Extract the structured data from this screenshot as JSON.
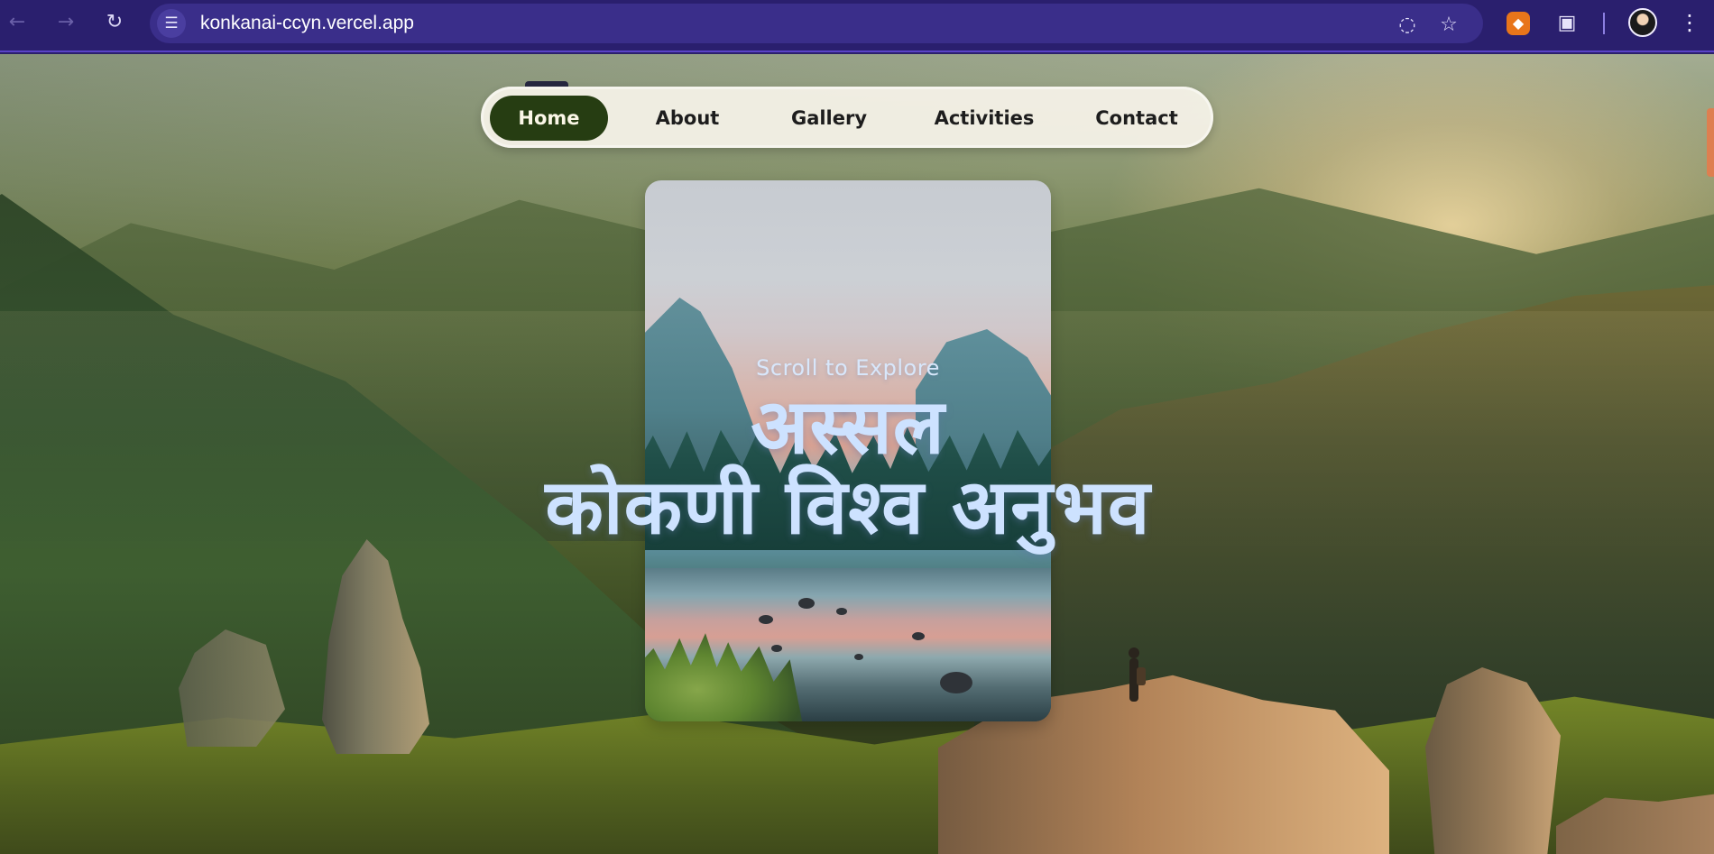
{
  "browser": {
    "url": "konkanai-ccyn.vercel.app",
    "icons": {
      "back": "arrow-left-icon",
      "forward": "arrow-right-icon",
      "reload": "reload-icon",
      "site_info": "site-info-icon",
      "hide": "eye-off-icon",
      "bookmark": "star-icon",
      "extension_metamask": "fox-icon",
      "extensions": "puzzle-icon",
      "profile": "avatar-icon",
      "menu": "more-vertical-icon"
    }
  },
  "navigation": {
    "items": [
      {
        "label": "Home"
      },
      {
        "label": "About"
      },
      {
        "label": "Gallery"
      },
      {
        "label": "Activities"
      },
      {
        "label": "Contact"
      }
    ]
  },
  "hero": {
    "scroll_text": "Scroll to Explore",
    "title_line_1": "अस्सल",
    "title_line_2": "कोकणी विश्व अनुभव"
  },
  "colors": {
    "browser_bar": "#2a1f6e",
    "nav_active": "#263d12",
    "nav_bg": "#f4f1e7",
    "hero_text": "#cde2ff",
    "scroll_indicator": "#de7f50"
  }
}
